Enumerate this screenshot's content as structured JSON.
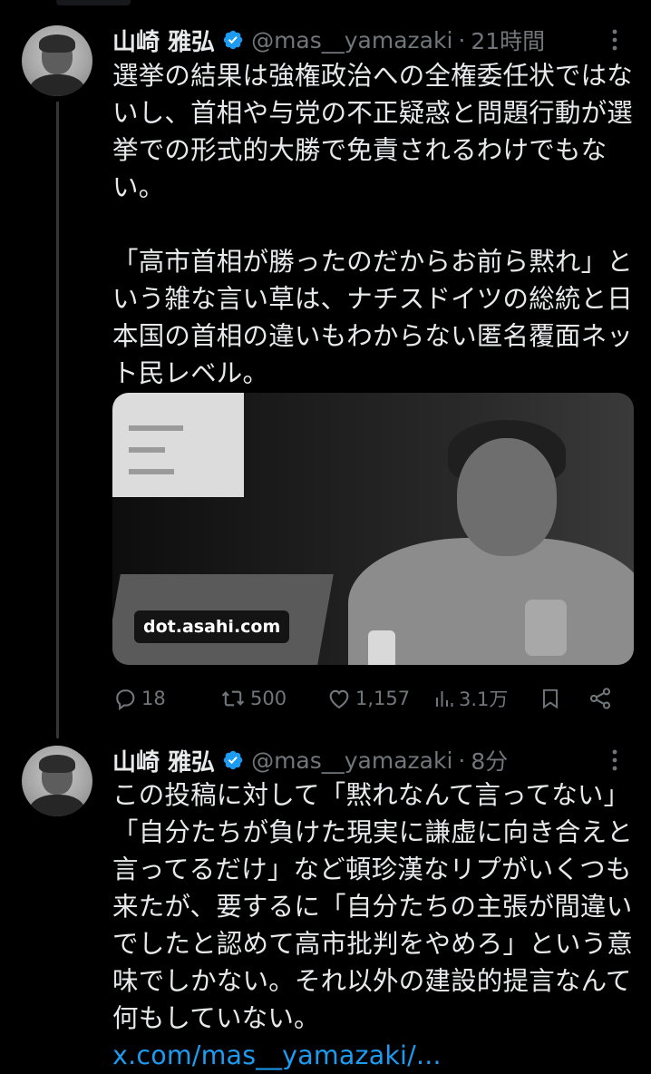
{
  "tweets": [
    {
      "name": "山崎 雅弘",
      "handle": "@mas__yamazaki",
      "time": "21時間",
      "text": "選挙の結果は強権政治への全権委任状ではないし、首相や与党の不正疑惑と問題行動が選挙での形式的大勝で免責されるわけでもない。\n\n「高市首相が勝ったのだからお前ら黙れ」という雑な言い草は、ナチスドイツの総統と日本国の首相の違いもわからない匿名覆面ネット民レベル。",
      "media_label": "dot.asahi.com",
      "stats": {
        "replies": "18",
        "retweets": "500",
        "likes": "1,157",
        "views": "3.1万"
      }
    },
    {
      "name": "山崎 雅弘",
      "handle": "@mas__yamazaki",
      "time": "8分",
      "text": "この投稿に対して「黙れなんて言ってない」「自分たちが負けた現実に謙虚に向き合えと言ってるだけ」など頓珍漢なリプがいくつも来たが、要するに「自分たちの主張が間違いでしたと認めて高市批判をやめろ」という意味でしかない。それ以外の建設的提言なんて何もしていない。",
      "link": "x.com/mas__yamazaki/..."
    }
  ],
  "separator": "·",
  "colors": {
    "background": "#000000",
    "text": "#e7e9ea",
    "secondary": "#71767b",
    "accent": "#1d9bf0"
  },
  "icons": {
    "verified": "verified-badge-icon",
    "more": "more-vertical-icon",
    "reply": "reply-icon",
    "retweet": "retweet-icon",
    "like": "heart-icon",
    "views": "views-chart-icon",
    "bookmark": "bookmark-icon",
    "share": "share-icon"
  }
}
